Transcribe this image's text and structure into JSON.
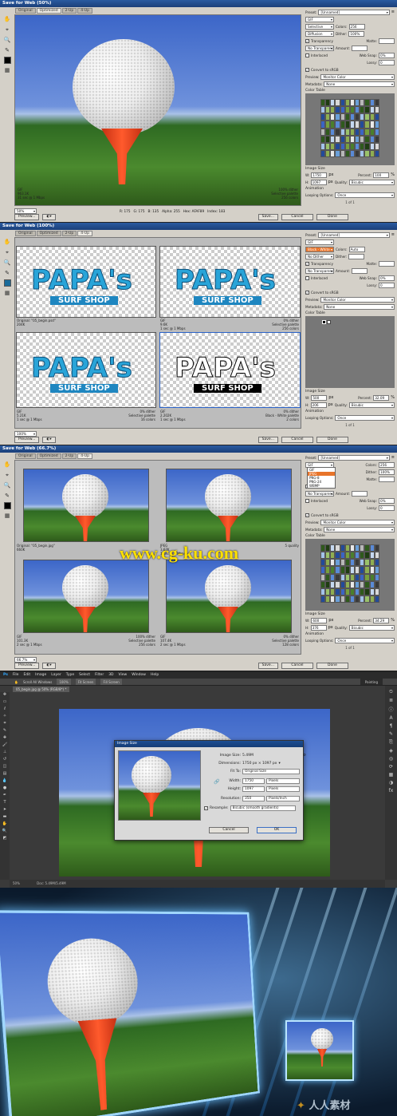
{
  "panel1": {
    "title": "Save for Web (50%)",
    "tabs": [
      "Original",
      "Optimized",
      "2-Up",
      "4-Up"
    ],
    "preset_label": "Preset:",
    "preset": "[Unnamed]",
    "format": "GIF",
    "reduction": "Selective",
    "dither_algo": "Diffusion",
    "colors_label": "Colors:",
    "colors": "256",
    "dither_label": "Dither:",
    "dither": "100%",
    "transparency": "Transparency",
    "matte_label": "Matte:",
    "trans_dither": "No Transparency Dither",
    "amount_label": "Amount:",
    "interlaced": "Interlaced",
    "websnap_label": "Web Snap:",
    "websnap": "0%",
    "lossy_label": "Lossy:",
    "lossy": "0",
    "convert_srgb": "Convert to sRGB",
    "preview_label": "Preview:",
    "preview": "Monitor Color",
    "metadata_label": "Metadata:",
    "metadata": "None",
    "color_table": "Color Table",
    "image_size": "Image Size",
    "w_label": "W:",
    "w": "1750",
    "h_label": "H:",
    "h": "1097",
    "px": "px",
    "percent_label": "Percent:",
    "percent": "100",
    "pct": "%",
    "quality_label": "Quality:",
    "quality": "Bicubic",
    "animation": "Animation",
    "looping_label": "Looping Options:",
    "looping": "Once",
    "frames": "1 of 1",
    "info_left": [
      "GIF",
      "963.1K",
      "31 sec @ 1 Mbps"
    ],
    "info_right": [
      "100% dither",
      "Selective palette",
      "256 colors"
    ],
    "status": [
      "R: 175",
      "G: 175",
      "B: 135",
      "Alpha: 255",
      "Hex: AFAF89",
      "Index: 183"
    ],
    "zoom": "50%",
    "btn_preview": "Preview...",
    "btn_save": "Save...",
    "btn_cancel": "Cancel",
    "btn_done": "Done"
  },
  "panel2": {
    "title": "Save for Web (100%)",
    "tabs": [
      "Original",
      "Optimized",
      "2-Up",
      "4-Up"
    ],
    "preset": "[Unnamed]",
    "format": "GIF",
    "reduction": "Black - White",
    "dither_algo": "No Dither",
    "colors": "Auto",
    "transparency": "Transparency",
    "trans_dither": "No Transparency Dither",
    "interlaced": "Interlaced",
    "websnap": "0%",
    "lossy": "0",
    "convert_srgb": "Convert to sRGB",
    "preview": "Monitor Color",
    "metadata": "None",
    "color_table": "Color Table",
    "image_size": "Image Size",
    "w": "500",
    "h": "206",
    "percent": "32.09",
    "quality": "Bicubic",
    "animation": "Animation",
    "looping": "Once",
    "frames": "1 of 1",
    "logo_main": "PAPA's",
    "logo_sub": "SURF SHOP",
    "panes": [
      {
        "left": [
          "Original: \"05_begin.psd\"",
          "204K"
        ],
        "right": []
      },
      {
        "left": [
          "GIF",
          "9.6K",
          "1 sec @ 1 Mbps"
        ],
        "right": [
          "0% dither",
          "Selective palette",
          "256 colors"
        ]
      },
      {
        "left": [
          "GIF",
          "5.21K",
          "1 sec @ 1 Mbps"
        ],
        "right": [
          "0% dither",
          "Selective palette",
          "16 colors"
        ]
      },
      {
        "left": [
          "GIF",
          "2.202K",
          "1 sec @ 1 Mbps"
        ],
        "right": [
          "0% dither",
          "Black - White palette",
          "2 colors"
        ]
      }
    ],
    "zoom": "100%",
    "btn_preview": "Preview...",
    "btn_save": "Save...",
    "btn_cancel": "Cancel",
    "btn_done": "Done"
  },
  "panel3": {
    "title": "Save for Web (66.7%)",
    "tabs": [
      "Original",
      "Optimized",
      "2-Up",
      "4-Up"
    ],
    "preset": "[Unnamed]",
    "format": "GIF",
    "format_options": [
      "GIF",
      "JPEG",
      "PNG-8",
      "PNG-24",
      "WBMP"
    ],
    "reduction": "Selective",
    "colors": "256",
    "dither": "100%",
    "transparency": "Transparency",
    "trans_dither": "No Transparency Dither",
    "interlaced": "Interlaced",
    "websnap": "0%",
    "lossy": "0",
    "convert_srgb": "Convert to sRGB",
    "preview": "Monitor Color",
    "metadata": "None",
    "color_table": "Color Table",
    "image_size": "Image Size",
    "w": "600",
    "h": "376",
    "percent": "34.29",
    "quality": "Bicubic",
    "animation": "Animation",
    "looping": "Once",
    "frames": "1 of 1",
    "panes": [
      {
        "left": [
          "Original: \"05_begin.jpg\"",
          "660K"
        ],
        "right": []
      },
      {
        "left": [
          "JPEG",
          "3.67K",
          "1 sec @ 1 Mbps"
        ],
        "right": [
          "5 quality"
        ]
      },
      {
        "left": [
          "GIF",
          "101.3K",
          "2 sec @ 1 Mbps"
        ],
        "right": [
          "100% dither",
          "Selective palette",
          "256 colors"
        ]
      },
      {
        "left": [
          "GIF",
          "107.4K",
          "2 sec @ 1 Mbps"
        ],
        "right": [
          "0% dither",
          "Selective palette",
          "128 colors"
        ]
      }
    ],
    "zoom": "66.7%",
    "btn_preview": "Preview...",
    "btn_save": "Save...",
    "btn_cancel": "Cancel",
    "btn_done": "Done"
  },
  "watermark": "www.cg-ku.com",
  "photoshop": {
    "logo": "Ps",
    "menu": [
      "File",
      "Edit",
      "Image",
      "Layer",
      "Type",
      "Select",
      "Filter",
      "3D",
      "View",
      "Window",
      "Help"
    ],
    "options": [
      "Scroll All Windows",
      "100%",
      "Fit Screen",
      "Fill Screen"
    ],
    "workspace": "Painting",
    "doc_tab": "05_begin.jpg @ 50% (RGB/8*) *",
    "status_zoom": "50%",
    "status_doc": "Doc: 5.49M/5.49M",
    "dialog": {
      "title": "Image Size",
      "image_size_label": "Image Size:",
      "image_size": "5.49M",
      "dimensions_label": "Dimensions:",
      "dimensions": "1750 px  ×  1097 px",
      "fit_to_label": "Fit To:",
      "fit_to": "Original Size",
      "width_label": "Width:",
      "width": "1750",
      "height_label": "Height:",
      "height": "1097",
      "unit": "Pixels",
      "resolution_label": "Resolution:",
      "resolution": "350",
      "res_unit": "Pixels/Inch",
      "resample_label": "Resample:",
      "resample": "Bicubic (smooth gradients)",
      "btn_cancel": "Cancel",
      "btn_ok": "OK"
    }
  },
  "promo": {
    "brand": "人人素材"
  }
}
